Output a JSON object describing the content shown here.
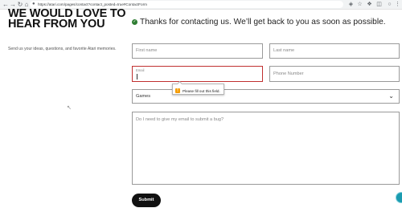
{
  "browser": {
    "url": "https://atari.com/pages/contact?contact_posted=true#ContactForm",
    "icons": {
      "back": "back-arrow-icon",
      "forward": "forward-arrow-icon",
      "reload": "reload-icon",
      "home": "home-icon",
      "lock": "lock-icon",
      "translate": "translate-icon",
      "bookmark": "star-icon",
      "extensions": "puzzle-icon",
      "menu": "menu-dots-icon"
    }
  },
  "page": {
    "heading": "WE WOULD LOVE TO HEAR FROM YOU",
    "intro": "Send us your ideas, questions, and favorite Atari memories."
  },
  "success": {
    "message": "Thanks for contacting us. We’ll get back to you as soon as possible.",
    "color": "#2e7d32"
  },
  "form": {
    "first_name_placeholder": "First name",
    "last_name_placeholder": "Last name",
    "email_label": "Email",
    "phone_placeholder": "Phone Number",
    "topic_selected": "Games",
    "message_placeholder": "Do I need to give my email to submit a bug?",
    "validation_tooltip": "Please fill out this field.",
    "submit_label": "Submit",
    "error_color": "#c03030"
  }
}
